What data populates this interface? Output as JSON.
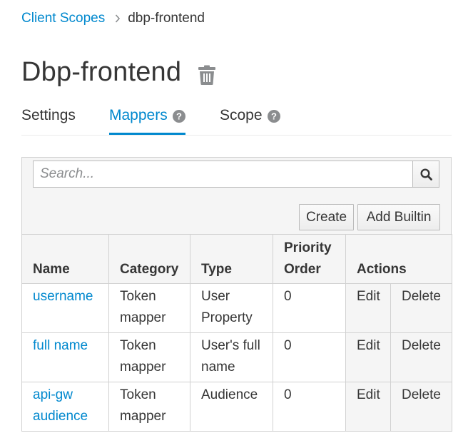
{
  "breadcrumb": {
    "parent": "Client Scopes",
    "current": "dbp-frontend"
  },
  "page": {
    "title": "Dbp-frontend"
  },
  "tabs": [
    {
      "label": "Settings",
      "active": false,
      "help": false
    },
    {
      "label": "Mappers",
      "active": true,
      "help": true
    },
    {
      "label": "Scope",
      "active": false,
      "help": true
    }
  ],
  "search": {
    "placeholder": "Search...",
    "value": ""
  },
  "buttons": {
    "create": "Create",
    "add_builtin": "Add Builtin"
  },
  "table": {
    "headers": {
      "name": "Name",
      "category": "Category",
      "type": "Type",
      "priority": "Priority Order",
      "actions": "Actions"
    },
    "rows": [
      {
        "name": "username",
        "category": "Token mapper",
        "type": "User Property",
        "priority": "0",
        "edit": "Edit",
        "delete": "Delete"
      },
      {
        "name": "full name",
        "category": "Token mapper",
        "type": "User's full name",
        "priority": "0",
        "edit": "Edit",
        "delete": "Delete"
      },
      {
        "name": "api-gw audience",
        "category": "Token mapper",
        "type": "Audience",
        "priority": "0",
        "edit": "Edit",
        "delete": "Delete"
      }
    ]
  },
  "colors": {
    "link": "#0088ce",
    "text": "#363636",
    "border": "#d1d1d1",
    "panel_bg": "#f5f5f5",
    "icon": "#8b8d8f"
  },
  "icons": {
    "breadcrumb_separator": "chevron-right-icon",
    "delete": "trash-icon",
    "help": "question-circle-icon",
    "search": "search-icon"
  }
}
